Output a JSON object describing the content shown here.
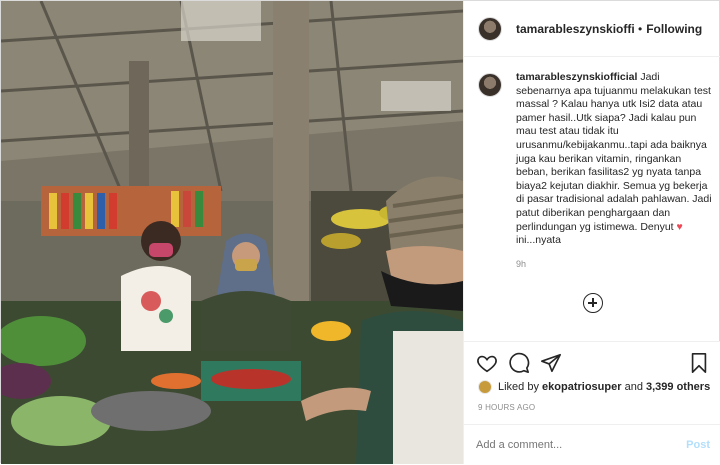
{
  "header": {
    "username": "tamarableszynskiofficial",
    "username_display": "tamarableszynskioffici",
    "separator": "•",
    "follow_label": "Following",
    "more_label": "..."
  },
  "caption": {
    "username": "tamarableszynskiofficial",
    "text": "Jadi sebenarnya apa tujuanmu melakukan test massal ? Kalau hanya utk Isi2 data atau pamer hasil..Utk siapa? Jadi kalau pun mau test atau tidak itu urusanmu/kebijakanmu..tapi ada baiknya juga kau berikan vitamin, ringankan beban, berikan fasilitas2 yg nyata tanpa biaya2 kejutan diakhir. Semua yg bekerja di pasar tradisional adalah pahlawan. Jadi patut diberikan penghargaan dan perlindungan yg istimewa. Denyut ♥ ini...nyata",
    "time": "9h"
  },
  "likes": {
    "prefix": "Liked by",
    "user": "ekopatriosuper",
    "and": "and",
    "count": "3,399 others"
  },
  "posted_ago": "9 HOURS AGO",
  "comment": {
    "placeholder": "Add a comment...",
    "post_label": "Post"
  },
  "colors": {
    "heart": "#ed4956",
    "post_button": "#b2dffc",
    "muted": "#8e8e8e"
  },
  "icons": [
    "heart-icon",
    "comment-icon",
    "share-icon",
    "bookmark-icon",
    "plus-circle-icon"
  ]
}
